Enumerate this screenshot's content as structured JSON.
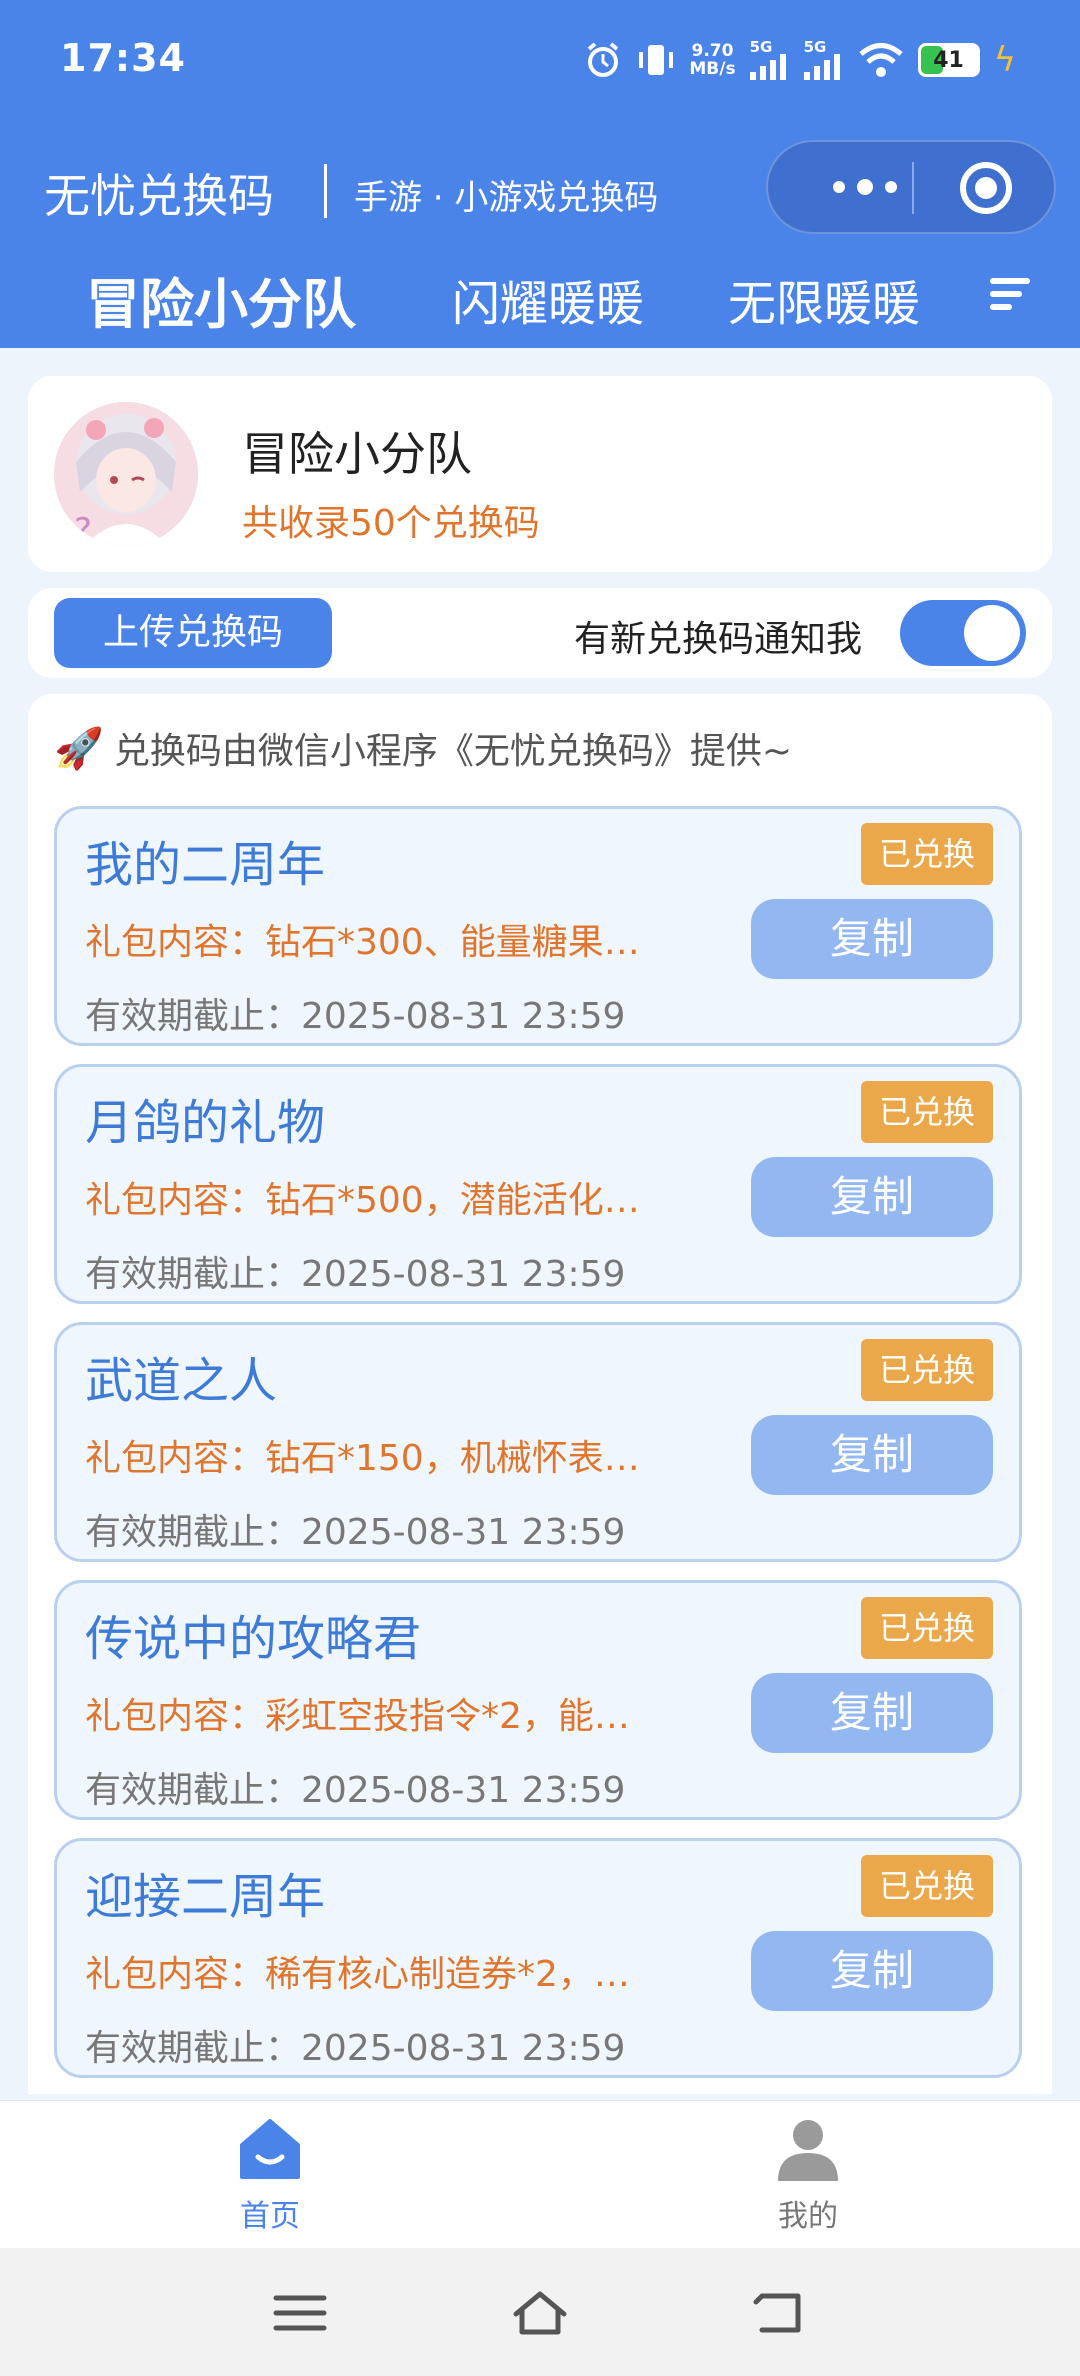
{
  "status_bar": {
    "time": "17:34",
    "net_speed_value": "9.70",
    "net_speed_unit": "MB/s",
    "sig1_label": "5G",
    "sig2_label": "5G",
    "battery": "41"
  },
  "header": {
    "title": "无忧兑换码",
    "subtitle": "手游 · 小游戏兑换码"
  },
  "tabs": [
    {
      "label": "冒险小分队",
      "active": true
    },
    {
      "label": "闪耀暖暖",
      "active": false
    },
    {
      "label": "无限暖暖",
      "active": false
    }
  ],
  "game": {
    "name": "冒险小分队",
    "count_text": "共收录50个兑换码"
  },
  "actions": {
    "upload_label": "上传兑换码",
    "notify_label": "有新兑换码通知我",
    "notify_on": true
  },
  "notice": "兑换码由微信小程序《无忧兑换码》提供~",
  "codes": [
    {
      "name": "我的二周年",
      "content": "礼包内容：钻石*300、能量糖果…",
      "expire": "有效期截止：2025-08-31 23:59",
      "badge": "已兑换",
      "copy": "复制"
    },
    {
      "name": "月鸽的礼物",
      "content": "礼包内容：钻石*500，潜能活化…",
      "expire": "有效期截止：2025-08-31 23:59",
      "badge": "已兑换",
      "copy": "复制"
    },
    {
      "name": "武道之人",
      "content": "礼包内容：钻石*150，机械怀表…",
      "expire": "有效期截止：2025-08-31 23:59",
      "badge": "已兑换",
      "copy": "复制"
    },
    {
      "name": "传说中的攻略君",
      "content": "礼包内容：彩虹空投指令*2，能…",
      "expire": "有效期截止：2025-08-31 23:59",
      "badge": "已兑换",
      "copy": "复制"
    },
    {
      "name": "迎接二周年",
      "content": "礼包内容：稀有核心制造券*2，…",
      "expire": "有效期截止：2025-08-31 23:59",
      "badge": "已兑换",
      "copy": "复制"
    }
  ],
  "bottom_nav": [
    {
      "label": "首页",
      "icon": "home-icon",
      "active": true
    },
    {
      "label": "我的",
      "icon": "user-icon",
      "active": false
    }
  ],
  "colors": {
    "primary": "#4a84e8",
    "accent_orange": "#e0762e",
    "badge": "#eaa84a",
    "copy_button": "#93b8f1"
  }
}
